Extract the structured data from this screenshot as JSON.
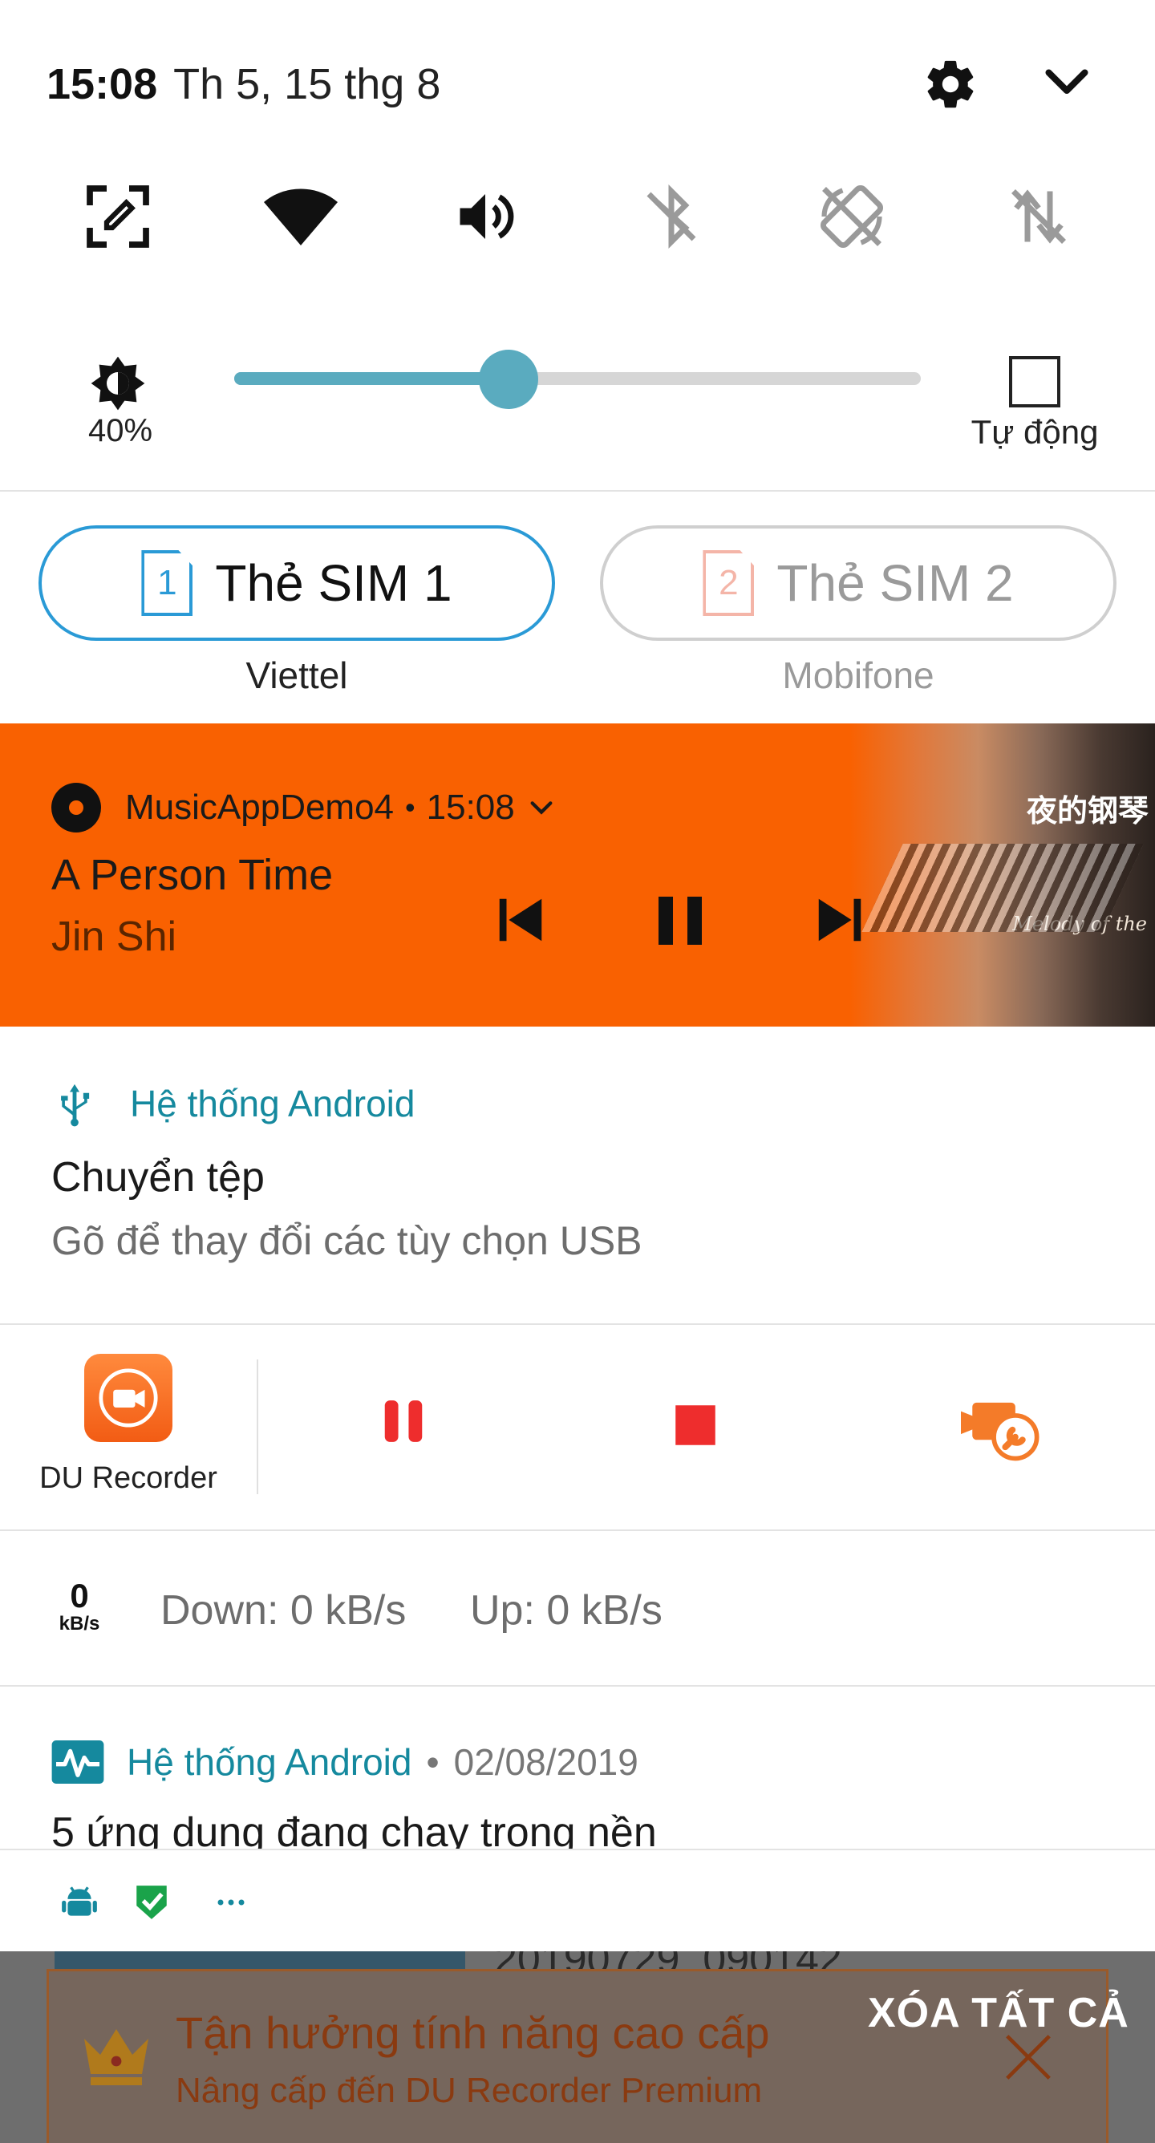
{
  "status": {
    "time": "15:08",
    "date": "Th 5, 15 thg 8"
  },
  "quick_settings": [
    {
      "icon": "screen-edit-icon",
      "active": true
    },
    {
      "icon": "wifi-icon",
      "active": true
    },
    {
      "icon": "volume-icon",
      "active": true
    },
    {
      "icon": "bluetooth-off-icon",
      "active": false
    },
    {
      "icon": "auto-rotate-off-icon",
      "active": false
    },
    {
      "icon": "mobile-data-off-icon",
      "active": false
    }
  ],
  "brightness": {
    "percent_label": "40%",
    "level": 0.4,
    "auto_label": "Tự động"
  },
  "sim": [
    {
      "number": "1",
      "label": "Thẻ SIM 1",
      "carrier": "Viettel",
      "active": true
    },
    {
      "number": "2",
      "label": "Thẻ SIM 2",
      "carrier": "Mobifone",
      "active": false
    }
  ],
  "music": {
    "app_name": "MusicAppDemo4",
    "separator": "•",
    "time": "15:08",
    "track": "A Person Time",
    "artist": "Jin Shi",
    "accent": "#f96101",
    "album_title": "夜的钢琴",
    "album_subtitle": "Melody of the"
  },
  "usb_notification": {
    "app": "Hệ thống Android",
    "title": "Chuyển tệp",
    "subtitle": "Gõ để thay đổi các tùy chọn USB",
    "accent": "#15899e"
  },
  "du_recorder": {
    "label": "DU Recorder",
    "control_color": "#ee2d2d"
  },
  "net_speed": {
    "value": "0",
    "unit": "kB/s",
    "down": "Down: 0 kB/s",
    "up": "Up: 0 kB/s"
  },
  "running_notification": {
    "app": "Hệ thống Android",
    "separator": "•",
    "date": "02/08/2019",
    "title": "5 ứng dụng đang chạy trong nền"
  },
  "actions": {
    "clear_all": "XÓA TẤT CẢ"
  },
  "underlay": {
    "file_name": "20190729_090142",
    "promo_title": "Tận hưởng tính năng cao cấp",
    "promo_subtitle": "Nâng cấp đến DU Recorder Premium"
  }
}
